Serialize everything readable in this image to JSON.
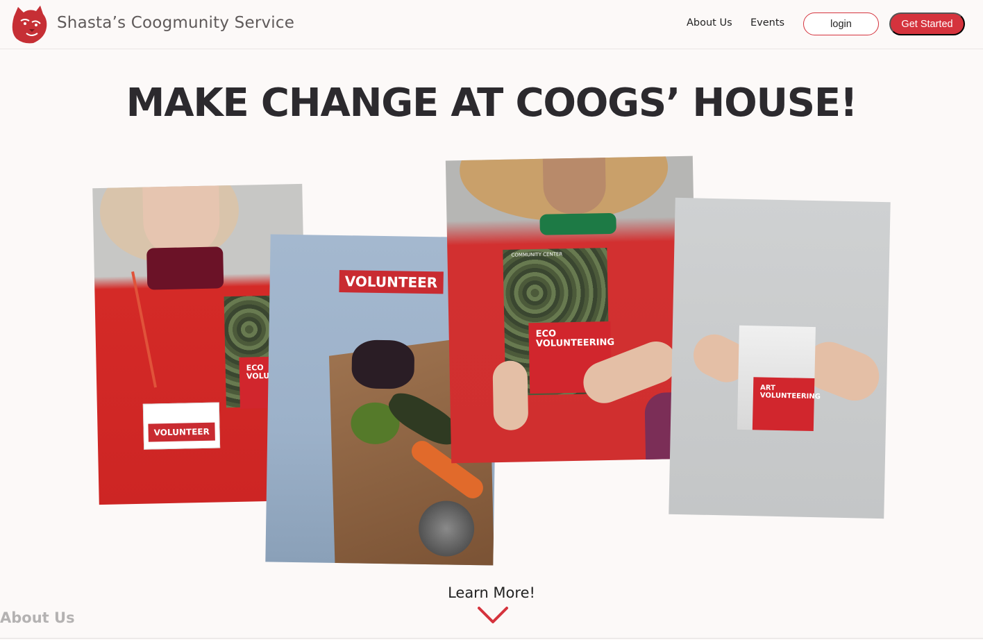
{
  "header": {
    "brand": "Shasta’s Coogmunity Service",
    "logo_icon": "cougar-head-icon",
    "nav": {
      "about": "About Us",
      "events": "Events"
    },
    "login_label": "login",
    "get_started_label": "Get Started"
  },
  "hero": {
    "headline": "MAKE CHANGE AT COOGS’ HOUSE!"
  },
  "photos": {
    "p1": {
      "badge": "VOLUNTEER",
      "card_title": "ECO VOLUNTEERING"
    },
    "p2": {
      "tag": "VOLUNTEER"
    },
    "p3": {
      "card_title": "ECO VOLUNTEERING",
      "header_small": "COMMUNITY CENTER"
    },
    "p4": {
      "card_title": "ART VOLUNTEERING"
    }
  },
  "cta": {
    "learn_more": "Learn More!",
    "chevron_icon": "chevron-down-icon"
  },
  "footer_section": {
    "title": "About Us"
  },
  "colors": {
    "accent": "#d5333d",
    "background": "#fcf9f8",
    "text": "#2c2a2e",
    "muted": "#b4b2b2"
  }
}
